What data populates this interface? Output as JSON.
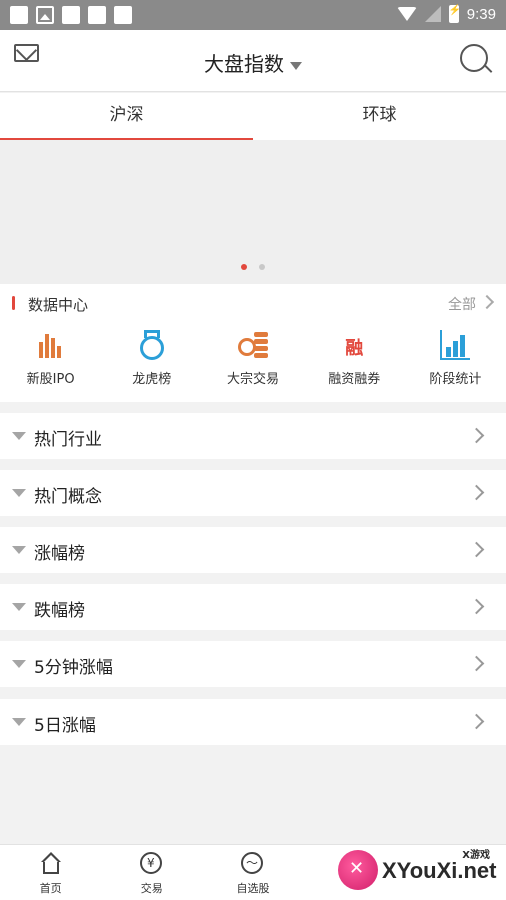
{
  "status_bar": {
    "time": "9:39"
  },
  "header": {
    "title": "大盘指数",
    "mail_icon": "mail-icon",
    "search_icon": "search-icon"
  },
  "tabs": [
    {
      "label": "沪深",
      "active": true
    },
    {
      "label": "环球",
      "active": false
    }
  ],
  "data_center": {
    "title": "数据中心",
    "all_label": "全部",
    "items": [
      {
        "label": "新股IPO",
        "icon": "ipo-icon"
      },
      {
        "label": "龙虎榜",
        "icon": "medal-icon"
      },
      {
        "label": "大宗交易",
        "icon": "coins-icon"
      },
      {
        "label": "融资融券",
        "icon": "margin-icon",
        "icon_text": "融"
      },
      {
        "label": "阶段统计",
        "icon": "bar-chart-icon"
      }
    ]
  },
  "sections": [
    {
      "label": "热门行业"
    },
    {
      "label": "热门概念"
    },
    {
      "label": "涨幅榜"
    },
    {
      "label": "跌幅榜"
    },
    {
      "label": "5分钟涨幅"
    },
    {
      "label": "5日涨幅"
    }
  ],
  "bottom_nav": [
    {
      "label": "首页",
      "icon": "home-icon"
    },
    {
      "label": "交易",
      "icon": "yen-icon",
      "glyph": "¥"
    },
    {
      "label": "自选股",
      "icon": "trend-icon",
      "glyph": "〜"
    }
  ],
  "watermark": {
    "text": "XYouXi.net",
    "small": "X游戏"
  },
  "colors": {
    "accent": "#e2483d",
    "blue": "#2b9fd8",
    "orange": "#e07b3c"
  }
}
